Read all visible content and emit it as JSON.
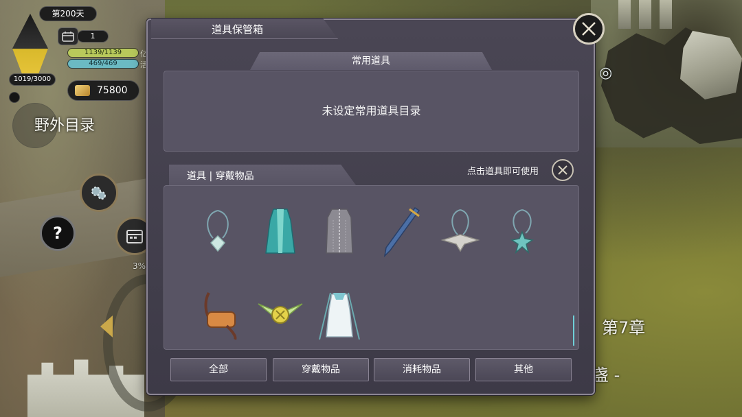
{
  "hud": {
    "day": "第200天",
    "crystal": "1019/3000",
    "calendar_count": "1",
    "hp": "1139/1139",
    "mp": "469/469",
    "gold": "75800",
    "field_list": "野外目录",
    "help_glyph": "?",
    "progress_percent": "3%",
    "hp_tag": "亿",
    "mp_tag": "活"
  },
  "modal": {
    "title": "道具保管箱",
    "favorites": {
      "header": "常用道具",
      "empty_text": "未设定常用道具目录"
    },
    "items": {
      "tab_label": "道具 | 穿戴物品",
      "hint": "点击道具即可使用",
      "slots": [
        {
          "icon": "pendant-clover-icon"
        },
        {
          "icon": "teal-robe-icon"
        },
        {
          "icon": "chain-vest-icon"
        },
        {
          "icon": "blue-sword-icon"
        },
        {
          "icon": "winged-amulet-icon"
        },
        {
          "icon": "star-pendant-icon"
        },
        {
          "icon": "leather-bag-icon"
        },
        {
          "icon": "winged-charm-icon"
        },
        {
          "icon": "white-dress-icon"
        }
      ]
    },
    "filters": [
      "全部",
      "穿戴物品",
      "消耗物品",
      "其他"
    ]
  },
  "world": {
    "chapter": "第7章",
    "subtitle": "一盏 -"
  },
  "colors": {
    "modal_bg": "#4a4654",
    "panel_bg": "#585464",
    "hp": "#b8c95b",
    "mp": "#6bbac3",
    "accent_scroll": "#6fd0d8"
  }
}
